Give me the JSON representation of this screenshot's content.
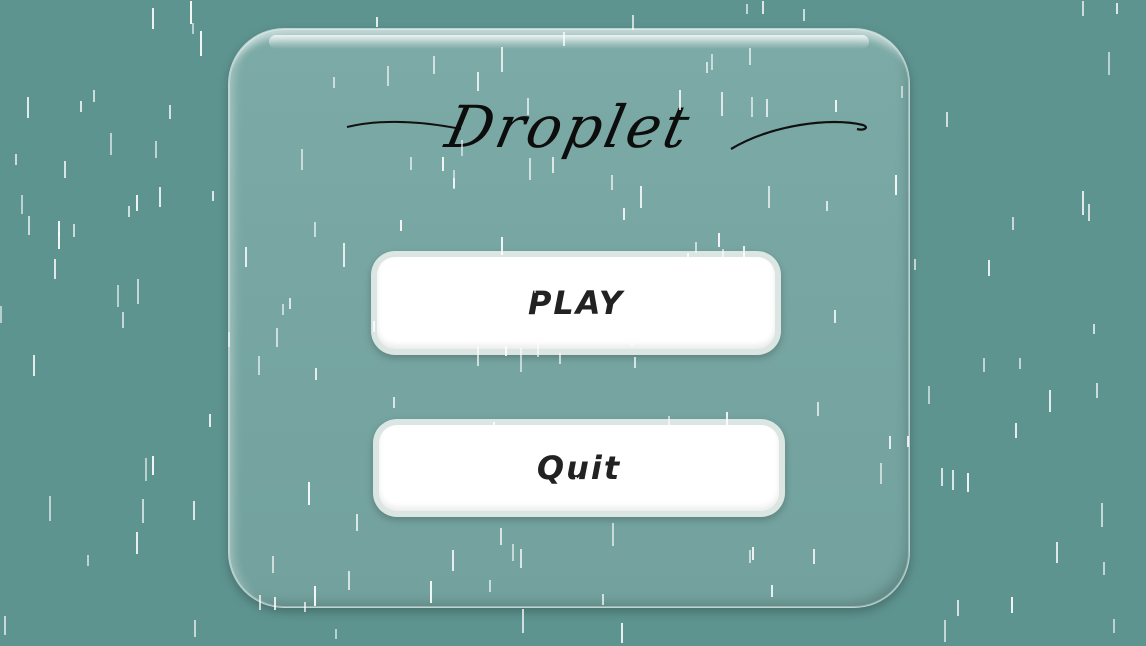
{
  "game": {
    "title": "Droplet"
  },
  "menu": {
    "play_label": "PLAY",
    "quit_label": "Quit"
  },
  "colors": {
    "background": "#5e9490",
    "panel": "#78a7a3",
    "button": "#ffffff",
    "rain": "#ffffff"
  }
}
